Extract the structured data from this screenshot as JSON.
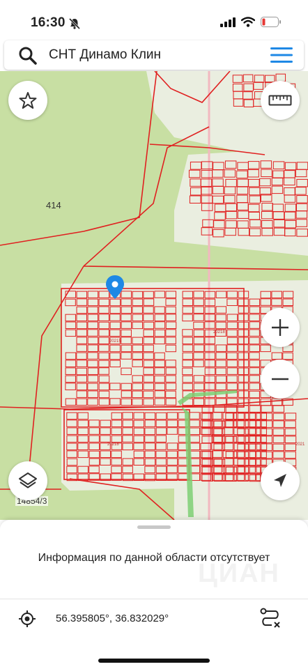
{
  "status_bar": {
    "time": "16:30",
    "battery_color": "#e53935"
  },
  "search": {
    "query": "СНТ Динамо Клин"
  },
  "map": {
    "labels": {
      "area_414": "414",
      "parcel_14854": "14854/3",
      "quarter_20215": "20215",
      "quarter_20218_top": "20218",
      "quarter_20218_bottom": "20218",
      "quarter_2021_edge": "2021"
    },
    "colors": {
      "forest": "#c8dfa3",
      "clearing": "#eaeee0",
      "parcel_line": "#e02020",
      "pin": "#1e88e5",
      "path": "#7ecf73"
    }
  },
  "info_panel": {
    "message": "Информация по данной области отсутствует",
    "watermark": "ЦИАН",
    "coordinates": "56.395805°, 36.832029°"
  }
}
